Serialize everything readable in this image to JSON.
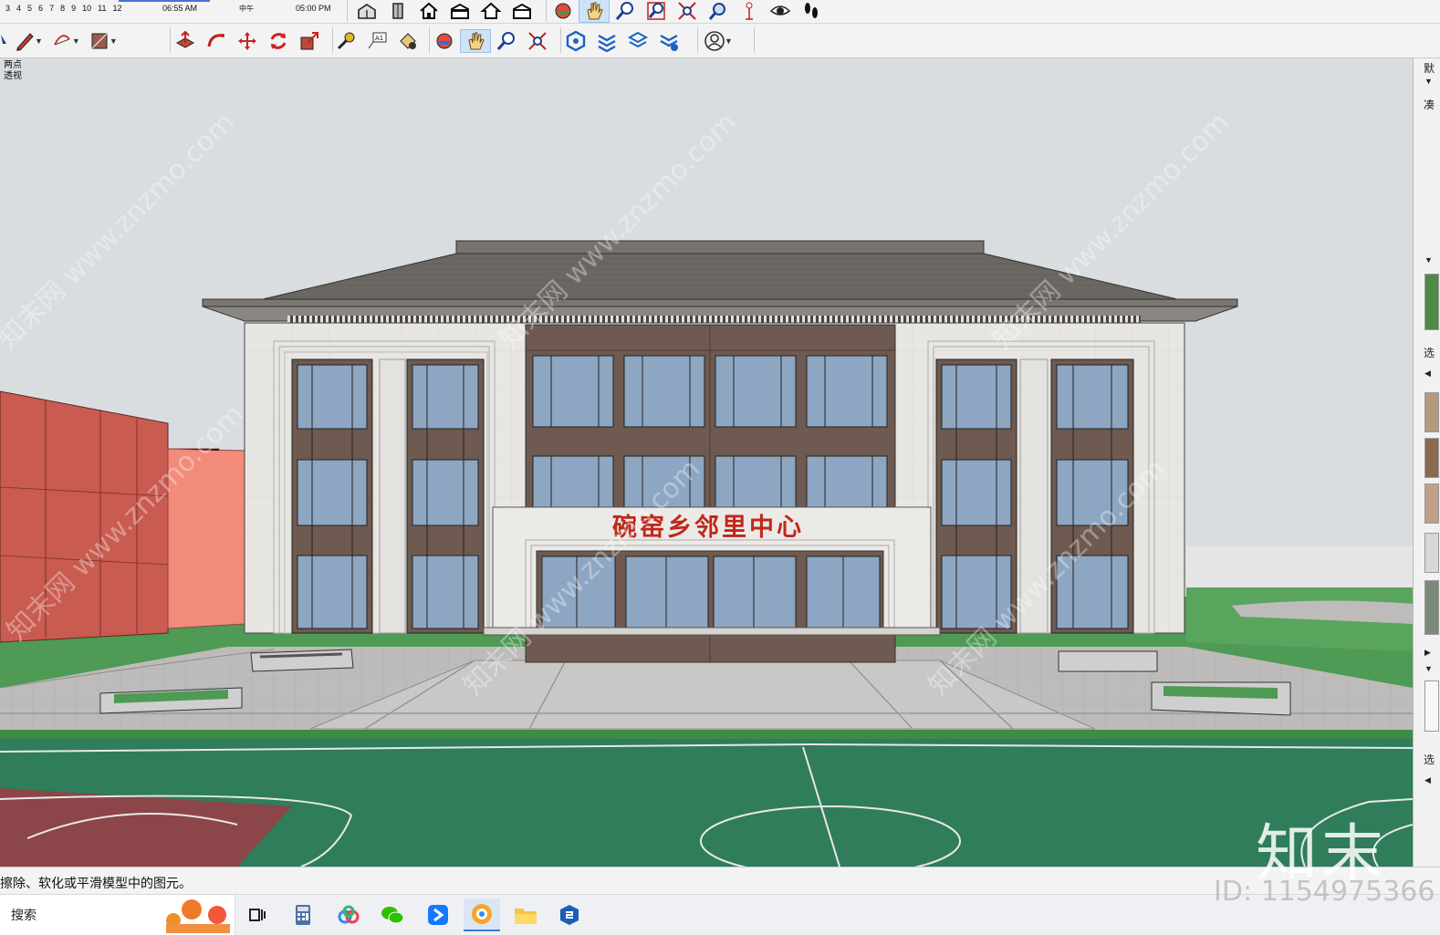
{
  "time_bar": {
    "months": [
      "3",
      "4",
      "5",
      "6",
      "7",
      "8",
      "9",
      "10",
      "11",
      "12"
    ],
    "sunrise": "06:55 AM",
    "noon": "中午",
    "sunset": "05:00 PM"
  },
  "toolbar_top": {
    "icons": [
      "iso-view-icon",
      "front-view-icon",
      "top-view-icon",
      "back-view-icon",
      "home-view-icon",
      "left-view-icon",
      "orbit-icon",
      "pan-icon",
      "zoom-icon",
      "zoom-window-icon",
      "zoom-extents-icon",
      "previous-view-icon",
      "position-camera-icon",
      "look-around-icon",
      "walk-icon"
    ]
  },
  "toolbar_main": {
    "icons": [
      "select-icon",
      "pencil-icon",
      "arc-icon",
      "rectangle-icon",
      "push-pull-icon",
      "follow-me-icon",
      "move-icon",
      "rotate-icon",
      "scale-icon",
      "tape-measure-icon",
      "text-icon",
      "paint-bucket-icon",
      "orbit-icon",
      "pan-icon",
      "zoom-icon",
      "zoom-extents-icon",
      "warehouse-icon",
      "extension-warehouse-icon",
      "layout-icon",
      "extension-manager-icon",
      "account-icon"
    ]
  },
  "viewport": {
    "scene_tab_line1": "两点",
    "scene_tab_line2": "透视",
    "building_sign": "碗窑乡邻里中心",
    "watermark": "知末网 www.znzmo.com"
  },
  "right_panel": {
    "label_top": "默",
    "label_2": "凑",
    "label_3": "选",
    "label_4": "选"
  },
  "status": {
    "message": "擦除、软化或平滑模型中的图元。"
  },
  "taskbar": {
    "search_label": "搜索",
    "apps": [
      "task-view-icon",
      "calculator-icon",
      "baidu-netdisk-icon",
      "wechat-icon",
      "feishu-icon",
      "browser-icon",
      "file-explorer-icon",
      "sketchup-icon"
    ]
  },
  "overlay": {
    "logo_text": "知末",
    "id_text": "ID: 1154975366"
  },
  "colors": {
    "sky": "#d9dde0",
    "roof": "#6b6763",
    "wall": "#e8e6e2",
    "glass": "#8da6c2",
    "frame": "#6e5a50",
    "sign": "#c0281c",
    "grass": "#4f9a54",
    "court": "#2f7d5a",
    "court_red": "#8c4548",
    "neighbor": "#c95b50",
    "accent": "#9bc1e8"
  }
}
